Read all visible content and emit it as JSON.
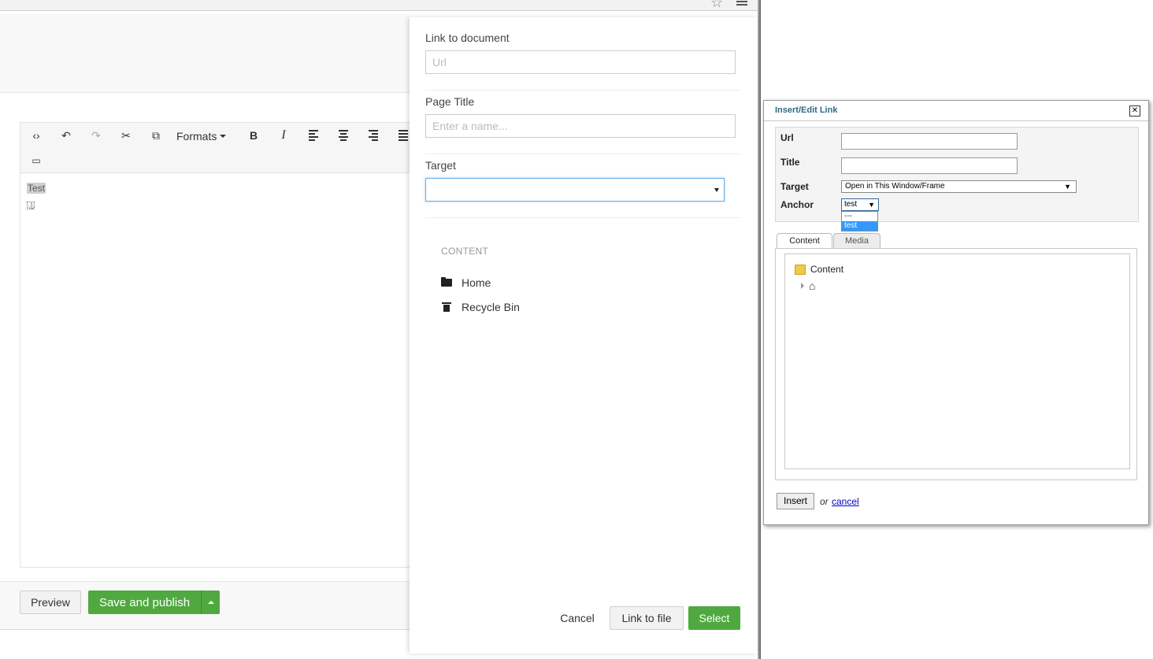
{
  "browser": {
    "star_icon": "star-icon",
    "menu_icon": "hamburger-menu-icon"
  },
  "editor": {
    "toolbar": {
      "formats_label": "Formats",
      "buttons": [
        "source-code",
        "undo",
        "redo",
        "cut",
        "copy",
        "formats",
        "bold",
        "italic",
        "align-left",
        "align-center",
        "align-right",
        "bullet-list",
        "embed-media"
      ]
    },
    "body_text": "Test",
    "anchor_marker": "⚓"
  },
  "actions": {
    "preview_label": "Preview",
    "save_publish_label": "Save and publish"
  },
  "link_panel": {
    "link_to_document_label": "Link to document",
    "url_placeholder": "Url",
    "page_title_label": "Page Title",
    "page_title_placeholder": "Enter a name...",
    "target_label": "Target",
    "target_value": "",
    "tree_header": "CONTENT",
    "tree_items": [
      {
        "label": "Home",
        "icon": "folder-icon"
      },
      {
        "label": "Recycle Bin",
        "icon": "trash-icon"
      }
    ],
    "cancel_label": "Cancel",
    "link_to_file_label": "Link to file",
    "select_label": "Select"
  },
  "legacy_dialog": {
    "title": "Insert/Edit Link",
    "close_glyph": "✕",
    "url_label": "Url",
    "url_value": "",
    "title_label": "Title",
    "title_value": "",
    "target_label": "Target",
    "target_value": "Open in This Window/Frame",
    "anchor_label": "Anchor",
    "anchor_value": "test",
    "anchor_options": [
      "---",
      "test"
    ],
    "tabs": [
      "Content",
      "Media"
    ],
    "active_tab": "Content",
    "tree_root": "Content",
    "insert_label": "Insert",
    "or_text": "or",
    "cancel_label": "cancel",
    "colors": {
      "title": "#2f6b82",
      "selected_option": "#3399ff",
      "link": "#0000cc"
    }
  },
  "colors": {
    "primary_green": "#50a940",
    "focus_blue": "#66afe9"
  }
}
